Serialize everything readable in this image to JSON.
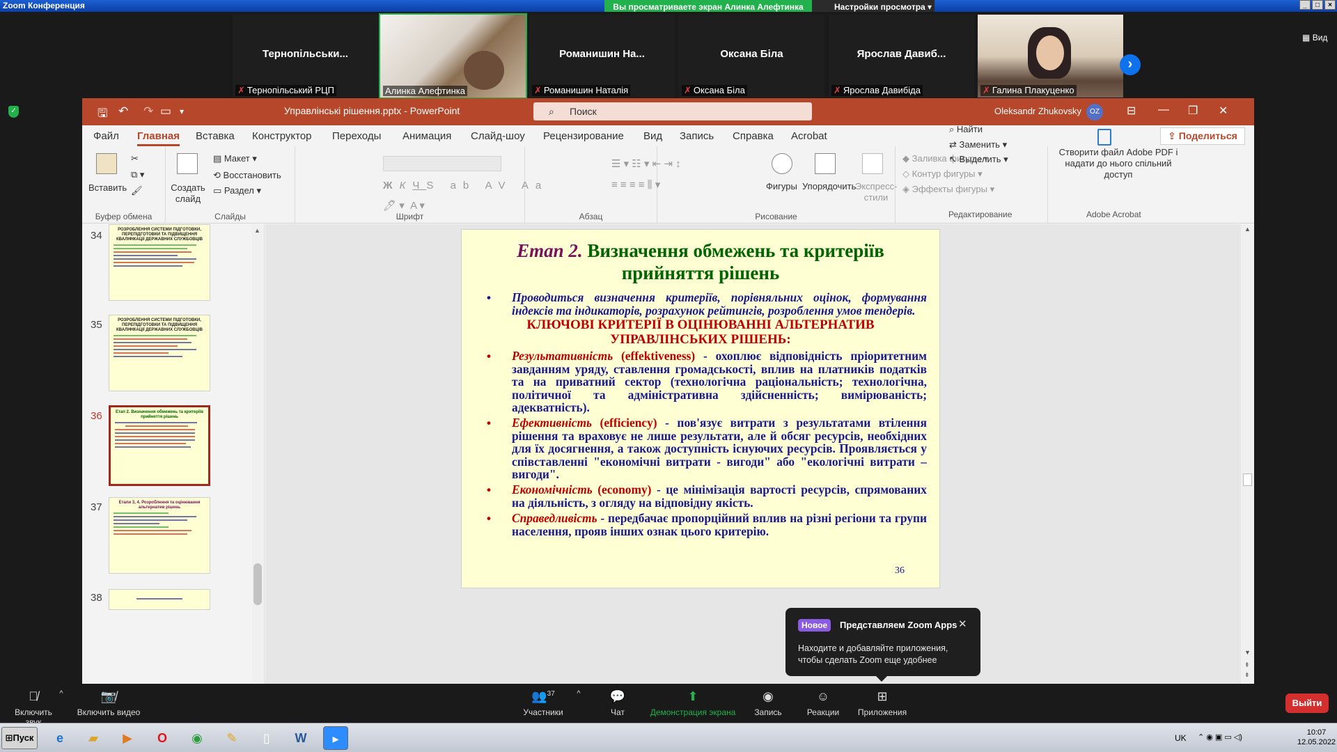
{
  "zoom": {
    "window_title": "Zoom Конференция",
    "share_banner": "Вы просматриваете экран Алинка Алефтинка",
    "view_options": "Настройки просмотра",
    "view_button": "Вид",
    "participants": [
      {
        "display_name": "Тернопільськи...",
        "caption": "Тернопільський РЦП",
        "muted": true,
        "video": false
      },
      {
        "display_name": "",
        "caption": "Алинка Алефтинка",
        "muted": false,
        "video": true
      },
      {
        "display_name": "Романишин  На...",
        "caption": "Романишин Наталія",
        "muted": true,
        "video": false
      },
      {
        "display_name": "Оксана Біла",
        "caption": "Оксана Біла",
        "muted": true,
        "video": false
      },
      {
        "display_name": "Ярослав  Давиб...",
        "caption": "Ярослав Давибіда",
        "muted": true,
        "video": false
      },
      {
        "display_name": "",
        "caption": "Галина Плакуценко",
        "muted": true,
        "video": true
      }
    ],
    "toolbar": {
      "audio": "Включить звук",
      "video": "Включить видео",
      "participants": "Участники",
      "participants_count": "37",
      "chat": "Чат",
      "share": "Демонстрация экрана",
      "record": "Запись",
      "reactions": "Реакции",
      "apps": "Приложения",
      "leave": "Выйти"
    },
    "toast": {
      "badge": "Новое",
      "title": "Представляем Zoom Apps",
      "text": "Находите и добавляйте приложения, чтобы сделать Zoom еще удобнее"
    }
  },
  "powerpoint": {
    "doc_title": "Управлінські рішення.pptx  -  PowerPoint",
    "search_placeholder": "Поиск",
    "user_name": "Oleksandr Zhukovsky",
    "user_initials": "OZ",
    "share_button": "Поделиться",
    "menu": [
      "Файл",
      "Главная",
      "Вставка",
      "Конструктор",
      "Переходы",
      "Анимация",
      "Слайд-шоу",
      "Рецензирование",
      "Вид",
      "Запись",
      "Справка",
      "Acrobat"
    ],
    "active_menu": "Главная",
    "ribbon": {
      "clipboard": {
        "paste": "Вставить",
        "label": "Буфер обмена"
      },
      "slides": {
        "new_slide": "Создать слайд",
        "layout": "Макет",
        "reset": "Восстановить",
        "section": "Раздел",
        "label": "Слайды"
      },
      "font": {
        "label": "Шрифт"
      },
      "paragraph": {
        "label": "Абзац"
      },
      "drawing": {
        "shapes": "Фигуры",
        "arrange": "Упорядочить",
        "quick_styles": "Экспресс-стили",
        "fill": "Заливка фигуры",
        "outline": "Контур фигуры",
        "effects": "Эффекты фигуры",
        "label": "Рисование"
      },
      "editing": {
        "find": "Найти",
        "replace": "Заменить",
        "select": "Выделить",
        "label": "Редактирование"
      },
      "adobe": {
        "create": "Створити файл Adobe PDF і надати до нього спільний доступ",
        "label": "Adobe Acrobat"
      }
    },
    "thumbnails": [
      {
        "num": "34",
        "title": "РОЗРОБЛЕННЯ СИСТЕМИ ПІДГОТОВКИ, ПЕРЕПІДГОТОВКИ ТА ПІДВИЩЕННЯ КВАЛІФІКАЦІЇ ДЕРЖАВНИХ СЛУЖБОВЦІВ",
        "selected": false
      },
      {
        "num": "35",
        "title": "РОЗРОБЛЕННЯ СИСТЕМИ ПІДГОТОВКИ, ПЕРЕПІДГОТОВКИ ТА ПІДВИЩЕННЯ КВАЛІФІКАЦІЇ ДЕРЖАВНИХ СЛУЖБОВЦІВ",
        "selected": false
      },
      {
        "num": "36",
        "title": "Етап 2. Визначення обмежень та критеріїв прийняття рішень",
        "selected": true
      },
      {
        "num": "37",
        "title": "Етапи 3, 4. Розроблення та оцінювання альтернатив рішень",
        "selected": false
      },
      {
        "num": "38",
        "title": "",
        "selected": false
      }
    ],
    "slide": {
      "stage": "Етап 2.",
      "title": "Визначення обмежень та критеріїв прийняття рішень",
      "intro": "Проводиться визначення критеріїв, порівняльних оцінок, формування індексів та індикаторів, розрахунок рейтингів, розроблення умов тендерів.",
      "heading": "КЛЮЧОВІ КРИТЕРІЇ В ОЦІНЮВАННІ АЛЬТЕРНАТИВ УПРАВЛІНСЬКИХ РІШЕНЬ:",
      "criteria": [
        {
          "term": "Результативність",
          "eng": "(effektiveness)",
          "text": " - охоплює відповідність пріоритетним завданням уряду, ставлення громадськості, вплив на платників податків та на приватний сектор (технологічна раціональність; технологічна, політичної та адміністративна здійсненність; вимірюваність; адекватність)."
        },
        {
          "term": "Ефективність",
          "eng": "(efficiency)",
          "text": " - пов'язує витрати з результатами втілення рішення та враховує не лише результати, але й обсяг ресурсів, необхідних для їх досягнення, а також доступність існуючих ресурсів. Проявляється у співставленні \"економічні витрати - вигоди\" або \"екологічні витрати – вигоди\"."
        },
        {
          "term": "Економічність",
          "eng": "(economy)",
          "text": " - це мінімізація вартості ресурсів, спрямованих на діяльність, з огляду на відповідну якість."
        },
        {
          "term": "Справедливість",
          "eng": "",
          "text": " - передбачає пропорційний вплив на різні регіони та групи населення, прояв інших ознак цього критерію."
        }
      ],
      "number": "36"
    }
  },
  "taskbar": {
    "start": "Пуск",
    "language": "UK",
    "time": "10:07",
    "date": "12.05.2022"
  }
}
